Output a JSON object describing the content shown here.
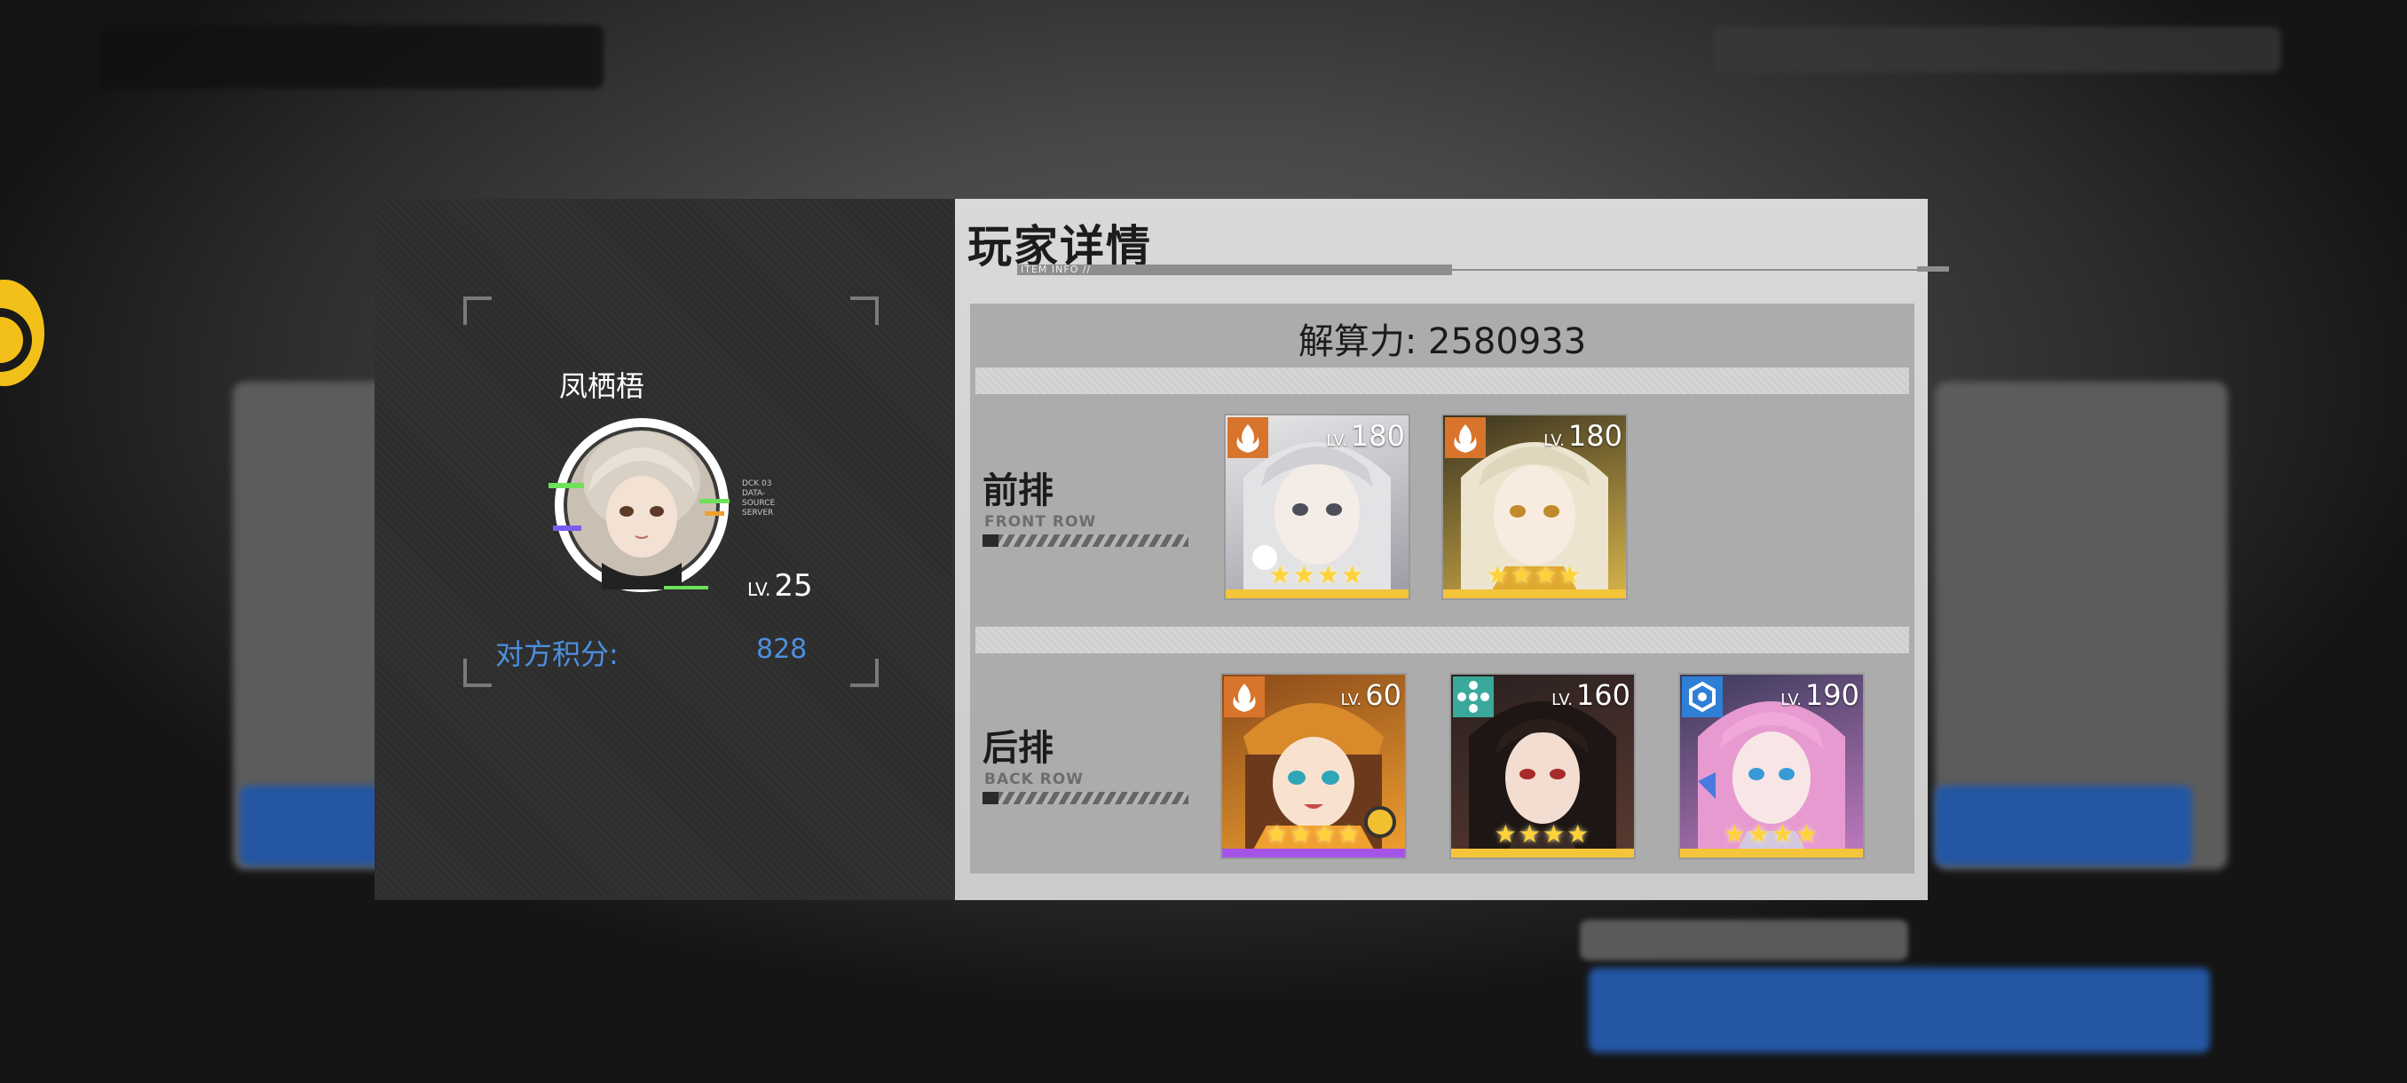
{
  "dialog": {
    "title": "玩家详情",
    "title_sub": "ITEM INFO //",
    "player": {
      "name": "凤栖梧",
      "level_prefix": "LV.",
      "level": "25",
      "score_label": "对方积分:",
      "score_value": "828",
      "avatar_tag_lines": [
        "DCK 03",
        "DATA-SOURCE",
        "SERVER"
      ]
    },
    "power_label": "解算力: 2580933",
    "rows": [
      {
        "label": "前排",
        "label_en": "FRONT ROW",
        "characters": [
          {
            "level_prefix": "LV.",
            "level": "180",
            "element_icon": "flame-element-icon",
            "element_color": "#d8742c",
            "stars": "★★★★",
            "rarity_color": "#f4c43a"
          },
          {
            "level_prefix": "LV.",
            "level": "180",
            "element_icon": "flame-element-icon",
            "element_color": "#d8742c",
            "stars": "★★★★",
            "rarity_color": "#f4c43a"
          }
        ]
      },
      {
        "label": "后排",
        "label_en": "BACK ROW",
        "characters": [
          {
            "level_prefix": "LV.",
            "level": "60",
            "element_icon": "flame-element-icon",
            "element_color": "#d8742c",
            "stars": "★★★★",
            "rarity_color": "#a455e8"
          },
          {
            "level_prefix": "LV.",
            "level": "160",
            "element_icon": "wind-element-icon",
            "element_color": "#3aa89a",
            "stars": "★★★★",
            "rarity_color": "#f4c43a"
          },
          {
            "level_prefix": "LV.",
            "level": "190",
            "element_icon": "hex-element-icon",
            "element_color": "#2f7fd6",
            "stars": "★★★★",
            "rarity_color": "#f4c43a"
          }
        ]
      }
    ]
  },
  "colors": {
    "score_text": "#4d8fdf",
    "left_panel": "#2d2d2d",
    "right_panel": "#d3d3d3"
  }
}
